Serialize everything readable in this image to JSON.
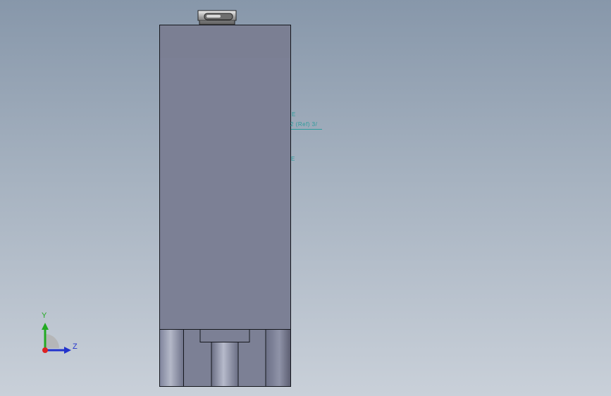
{
  "viewport": {
    "background_top": "#8797aa",
    "background_bottom": "#c9d0d9"
  },
  "model": {
    "body_color": "#7c8095",
    "edge_color": "#15171d"
  },
  "annotations": {
    "tick_top": "E",
    "leader_label": "2 (Ref) 3/",
    "tick_bottom": "E",
    "color": "#2d9c9c"
  },
  "triad": {
    "y_label": "Y",
    "z_label": "Z",
    "y_color": "#22aa22",
    "z_color": "#2233cc",
    "origin_color": "#dd2222"
  }
}
